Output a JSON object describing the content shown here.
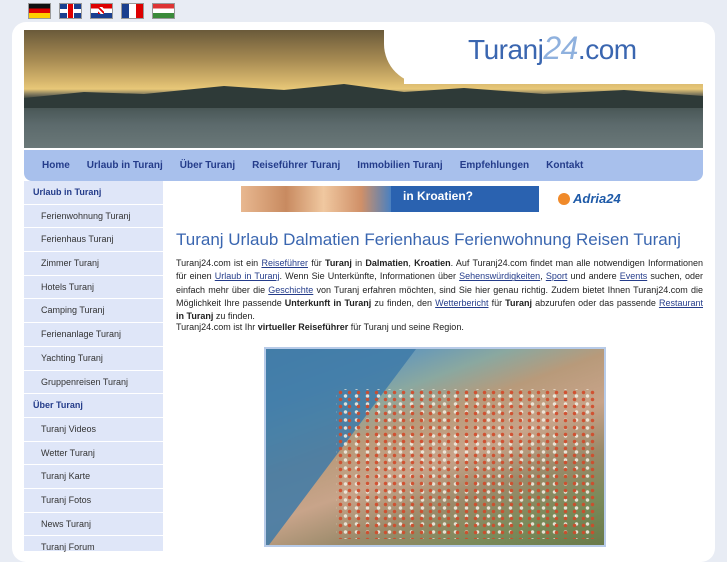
{
  "languages": [
    {
      "name": "de-flag-icon"
    },
    {
      "name": "uk-flag-icon"
    },
    {
      "name": "hr-flag-icon"
    },
    {
      "name": "fr-flag-icon"
    },
    {
      "name": "hu-flag-icon"
    }
  ],
  "logo": {
    "prefix": "Turanj",
    "number": "24",
    "suffix": ".com"
  },
  "nav": [
    "Home",
    "Urlaub in Turanj",
    "Über Turanj",
    "Reiseführer Turanj",
    "Immobilien Turanj",
    "Empfehlungen",
    "Kontakt"
  ],
  "sidebar": {
    "section1": "Urlaub in Turanj",
    "items1": [
      "Ferienwohnung Turanj",
      "Ferienhaus Turanj",
      "Zimmer Turanj",
      "Hotels Turanj",
      "Camping Turanj",
      "Ferienanlage Turanj",
      "Yachting Turanj",
      "Gruppenreisen Turanj"
    ],
    "section2": "Über Turanj",
    "items2": [
      "Turanj Videos",
      "Wetter Turanj",
      "Turanj Karte",
      "Turanj Fotos",
      "News Turanj",
      "Turanj Forum"
    ]
  },
  "banner": {
    "text": "in Kroatien?",
    "brand": "Adria24"
  },
  "main": {
    "title": "Turanj Urlaub Dalmatien Ferienhaus Ferienwohnung Reisen Turanj",
    "p1": {
      "t1": "Turanj24.com ist ein ",
      "l_reisefuehrer": "Reiseführer",
      "t2": " für ",
      "b_turanj": "Turanj",
      "t3": " in ",
      "b_dalmatien": "Dalmatien",
      "t4": ", ",
      "b_kroatien": "Kroatien",
      "t5": ". Auf Turanj24.com findet man alle notwendigen Informationen für einen ",
      "l_urlaub": "Urlaub in Turanj",
      "t6": ". Wenn Sie Unterkünfte, Informationen über ",
      "l_sehens": "Sehenswürdigkeiten",
      "t7": ", ",
      "l_sport": "Sport",
      "t8": " und andere ",
      "l_events": "Events",
      "t9": " suchen, oder einfach mehr über die ",
      "l_geschichte": "Geschichte",
      "t10": " von Turanj erfahren möchten, sind Sie hier genau richtig. Zudem bietet Ihnen Turanj24.com die Möglichkeit Ihre passende ",
      "b_unterkunft": "Unterkunft in Turanj",
      "t11": " zu finden, den ",
      "l_wetter": "Wetterbericht",
      "t12": " für ",
      "b_turanj2": "Turanj",
      "t13": " abzurufen oder das passende ",
      "l_restaurant": "Restaurant",
      "t14": " ",
      "b_inturanj": "in Turanj",
      "t15": " zu finden."
    },
    "p2": {
      "t1": "Turanj24.com ist Ihr ",
      "b1": "virtueller Reiseführer",
      "t2": " für Turanj und seine Region."
    }
  }
}
